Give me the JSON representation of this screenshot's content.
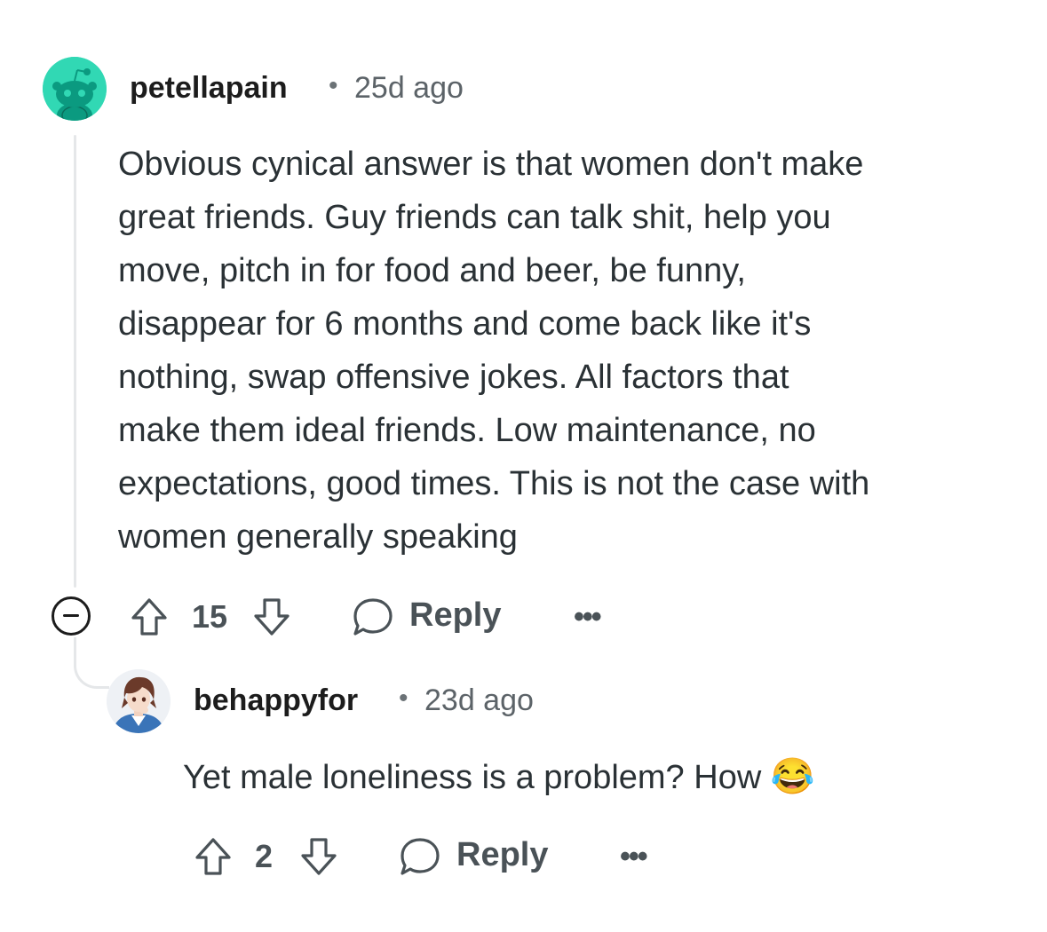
{
  "comments": [
    {
      "username": "petellapain",
      "separator": "•",
      "time": "25d ago",
      "body_lines": [
        "Obvious cynical answer is that women don't make",
        "great friends. Guy friends can talk shit, help you",
        "move, pitch in for food and beer, be funny,",
        "disappear for 6 months and come back like it's",
        "nothing, swap offensive jokes. All factors that",
        "make them ideal friends. Low maintenance, no",
        "expectations, good times. This is not the case with",
        "women generally speaking"
      ],
      "votes": "15",
      "reply_label": "Reply",
      "more_label": "•••",
      "avatar_icon": "snoo-avatar-icon",
      "avatar_color": "#31d8b4"
    },
    {
      "username": "behappyfor",
      "separator": "•",
      "time": "23d ago",
      "body": "Yet male loneliness is a problem? How",
      "emoji": "😂",
      "votes": "2",
      "reply_label": "Reply",
      "more_label": "•••",
      "avatar_icon": "anime-character-avatar-icon"
    }
  ],
  "icons": {
    "upvote": "arrow-up-icon",
    "downvote": "arrow-down-icon",
    "reply": "speech-bubble-icon",
    "collapse": "minus-circle-icon"
  },
  "colors": {
    "text": "#1c1c1c",
    "muted": "#5c6368",
    "action": "#4a5257",
    "thread_line": "#e5e7e9"
  }
}
